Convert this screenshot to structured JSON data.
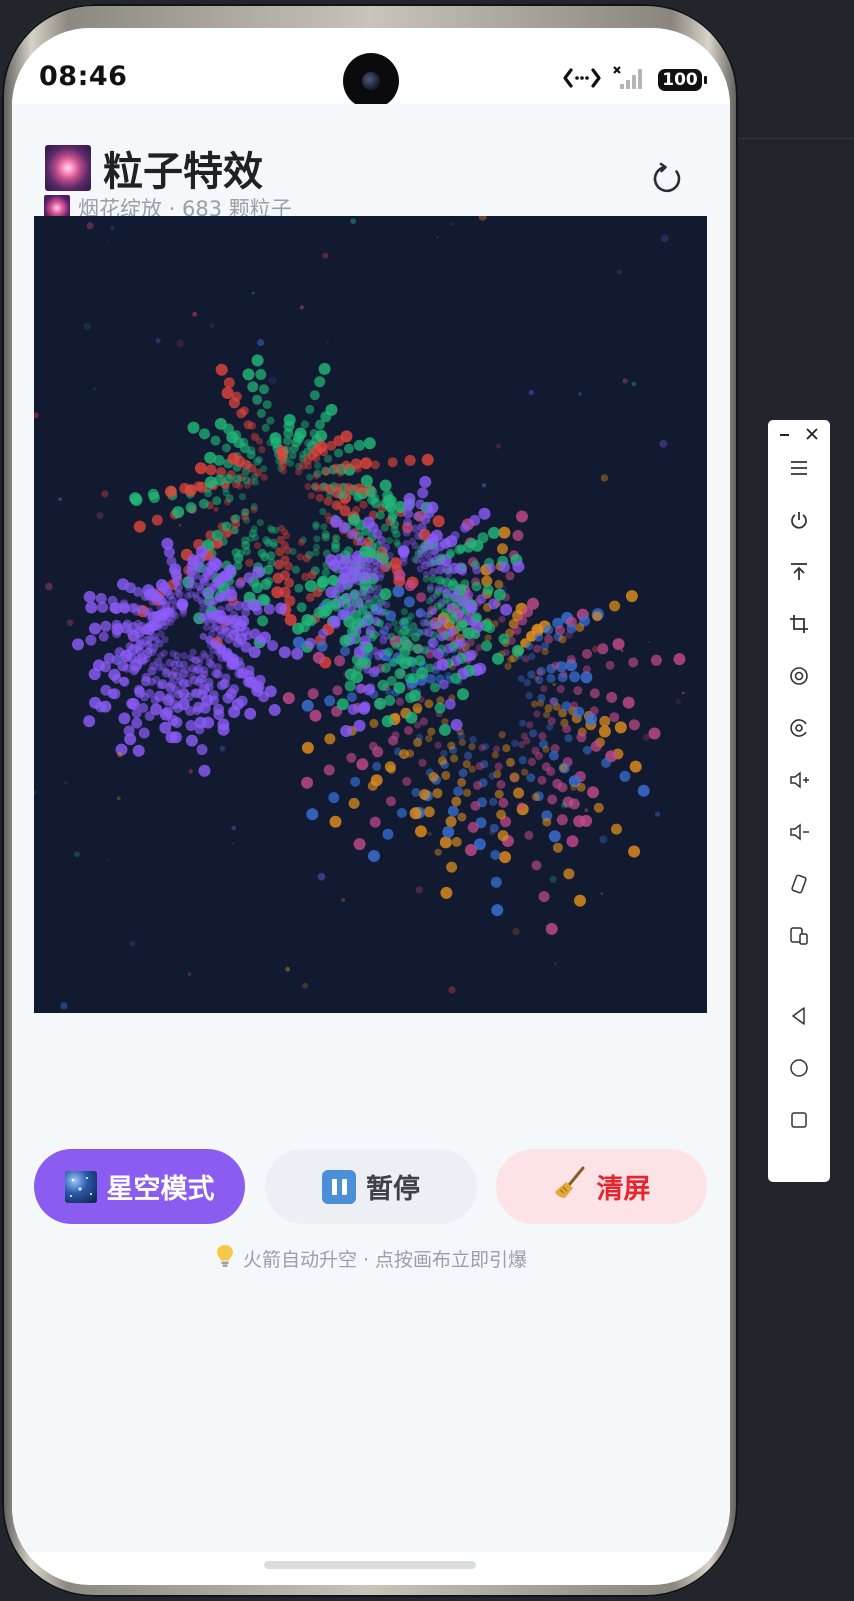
{
  "status_bar": {
    "time": "08:46",
    "battery": "100",
    "icons": [
      "data-transfer-icon",
      "signal-no-service-icon",
      "battery-icon"
    ]
  },
  "header": {
    "title": "粒子特效",
    "subtitle": "烟花绽放 · 683 颗粒子",
    "title_icon": "fireworks-icon",
    "reload_icon": "reload-icon"
  },
  "canvas": {
    "background": "#111a31",
    "particle_colors": [
      "#e0463d",
      "#21b779",
      "#8b5cf6",
      "#3a72d6",
      "#e08e1c",
      "#c24a8a"
    ]
  },
  "controls": {
    "starry_label": "星空模式",
    "pause_label": "暂停",
    "clear_label": "清屏",
    "starry_color": "#8b5cf0",
    "clear_color": "#e8242f"
  },
  "hint": {
    "icon": "lightbulb-icon",
    "text": "火箭自动升空 · 点按画布立即引爆"
  },
  "emulator_toolbar": {
    "items": [
      "minimize-icon",
      "close-icon",
      "menu-icon",
      "power-icon",
      "pin-top-icon",
      "crop-icon",
      "rotate-icon",
      "screenshot-icon",
      "volume-up-icon",
      "volume-down-icon",
      "rotate-device-icon",
      "multi-device-icon",
      "back-icon",
      "home-icon",
      "recents-icon"
    ]
  }
}
